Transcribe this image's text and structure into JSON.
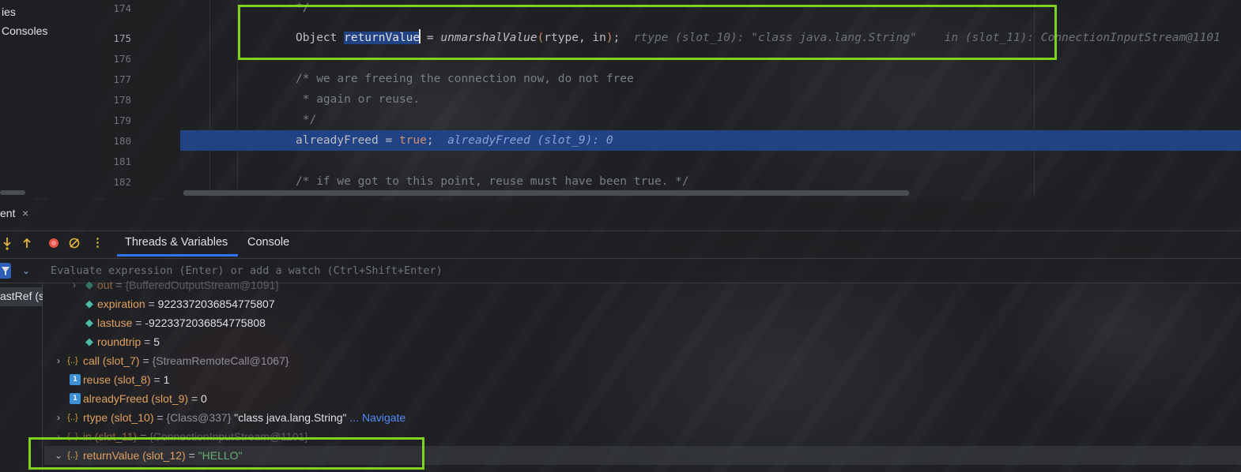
{
  "sidebar": {
    "items": [
      "ies",
      "Consoles"
    ]
  },
  "editor": {
    "lines": [
      {
        "num": "174",
        "parts": [
          {
            "t": "*/",
            "c": "cm"
          }
        ]
      },
      {
        "num": "175",
        "parts": [
          {
            "t": "Object ",
            "c": ""
          },
          {
            "t": "returnValue",
            "c": "sel"
          },
          {
            "t": "CARET",
            "c": "caret"
          },
          {
            "t": " = ",
            "c": ""
          },
          {
            "t": "unmarshalValue",
            "c": "fn"
          },
          {
            "t": "(",
            "c": "kw"
          },
          {
            "t": "rtype, in",
            "c": ""
          },
          {
            "t": ")",
            "c": "kw"
          },
          {
            "t": ";",
            "c": ""
          },
          {
            "t": "  rtype (slot_10): \"class java.lang.String\"    in (slot_11): ConnectionInputStream@1101",
            "c": "inlay"
          }
        ]
      },
      {
        "num": "176",
        "parts": []
      },
      {
        "num": "177",
        "parts": [
          {
            "t": "/* we are freeing the connection now, do not free",
            "c": "cm"
          }
        ]
      },
      {
        "num": "178",
        "parts": [
          {
            "t": " * again or reuse.",
            "c": "cm"
          }
        ]
      },
      {
        "num": "179",
        "parts": [
          {
            "t": " */",
            "c": "cm"
          }
        ]
      },
      {
        "num": "180",
        "parts": [
          {
            "t": "alreadyFreed = ",
            "c": ""
          },
          {
            "t": "true",
            "c": "kw"
          },
          {
            "t": ";",
            "c": ""
          },
          {
            "t": "  alreadyFreed (slot_9): 0",
            "c": "inlay"
          }
        ]
      },
      {
        "num": "181",
        "parts": []
      },
      {
        "num": "182",
        "parts": [
          {
            "t": "/* if we got to this point, reuse must have been true. */",
            "c": "cm"
          }
        ]
      }
    ]
  },
  "debug": {
    "tool_title": "ent",
    "close_glyph": "×",
    "tabs": [
      "Threads & Variables",
      "Console"
    ],
    "eval_placeholder": "Evaluate expression (Enter) or add a watch (Ctrl+Shift+Enter)",
    "frame_label": "astRef (s"
  },
  "variables": [
    {
      "chev": "›",
      "icon": "field",
      "name": "out",
      "eq": " = ",
      "ref": "{BufferedOutputStream@1091}",
      "faded": true
    },
    {
      "chev": "",
      "icon": "field",
      "name": "expiration",
      "eq": " = ",
      "val": "9223372036854775807"
    },
    {
      "chev": "",
      "icon": "field",
      "name": "lastuse",
      "eq": " = ",
      "val": "-9223372036854775808"
    },
    {
      "chev": "",
      "icon": "field",
      "name": "roundtrip",
      "eq": " = ",
      "val": "5"
    },
    {
      "chev": "›",
      "icon": "obj",
      "name": "call (slot_7)",
      "eq": " = ",
      "ref": "{StreamRemoteCall@1067}"
    },
    {
      "chev": "",
      "icon": "prim",
      "name": "reuse (slot_8)",
      "eq": " = ",
      "val": "1"
    },
    {
      "chev": "",
      "icon": "prim",
      "name": "alreadyFreed (slot_9)",
      "eq": " = ",
      "val": "0"
    },
    {
      "chev": "›",
      "icon": "obj",
      "name": "rtype (slot_10)",
      "eq": " = ",
      "ref": "{Class@337}",
      "str": " \"class java.lang.String\"",
      "link": " ... Navigate"
    },
    {
      "chev": "›",
      "icon": "obj",
      "name": "in (slot_11)",
      "eq": " = ",
      "ref": "{ConnectionInputStream@1101}",
      "faded": true
    },
    {
      "chev": "⌄",
      "icon": "obj",
      "name": "returnValue (slot_12)",
      "eq": " = ",
      "green": "\"HELLO\"",
      "selected": true
    }
  ],
  "icons": {
    "step_into": "step-into-icon",
    "step_out": "step-out-icon",
    "breakpoints": "view-breakpoints-icon",
    "mute": "mute-breakpoints-icon",
    "more": "more-options-icon",
    "filter": "filter-icon",
    "field": "field-icon",
    "object": "object-icon",
    "primitive": "primitive-icon"
  },
  "colors": {
    "highlight_box": "#7ed321",
    "exec_line": "#214283",
    "keyword": "#cf8e6d",
    "string": "#6aab73",
    "link": "#548af7"
  }
}
